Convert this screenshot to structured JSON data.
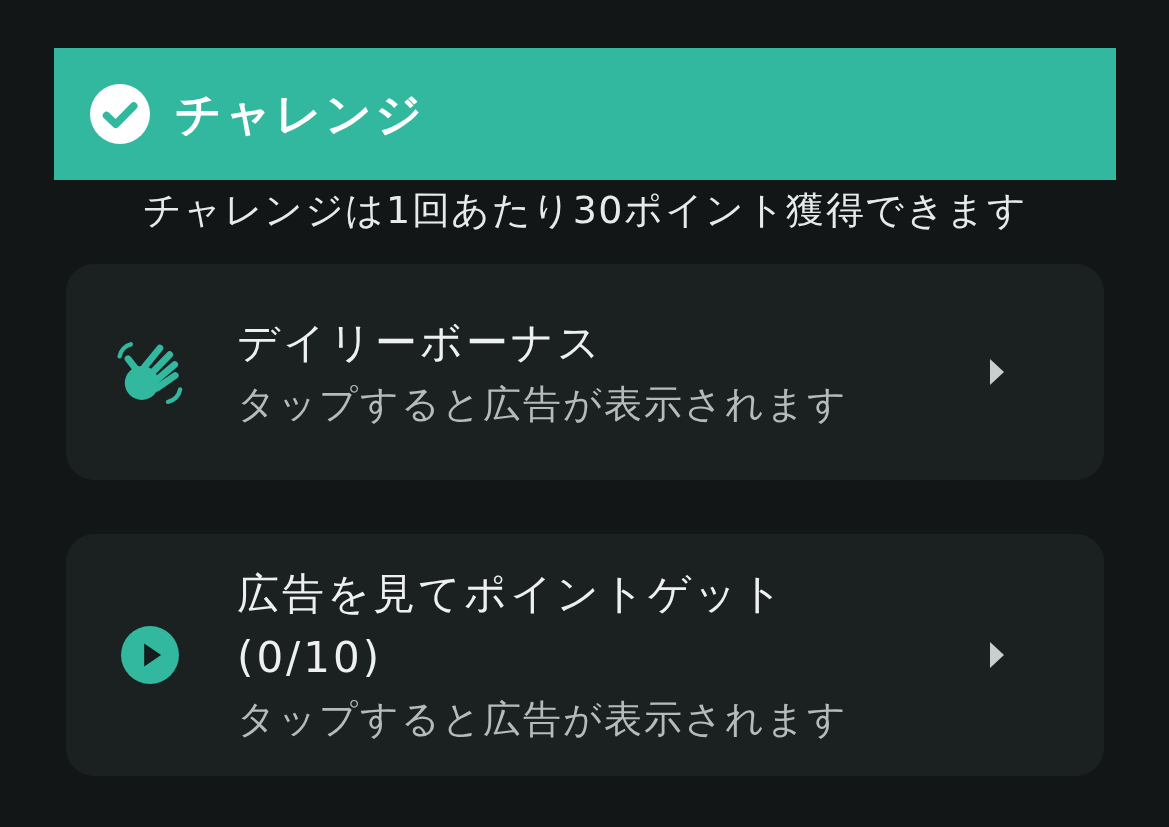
{
  "section": {
    "title": "チャレンジ",
    "description": "チャレンジは1回あたり30ポイント獲得できます"
  },
  "items": [
    {
      "kind": "daily_bonus",
      "title": "デイリーボーナス",
      "subtitle": "タップすると広告が表示されます"
    },
    {
      "kind": "video_ad",
      "title": "広告を見てポイントゲット",
      "count": "(0/10)",
      "subtitle": "タップすると広告が表示されます"
    }
  ]
}
